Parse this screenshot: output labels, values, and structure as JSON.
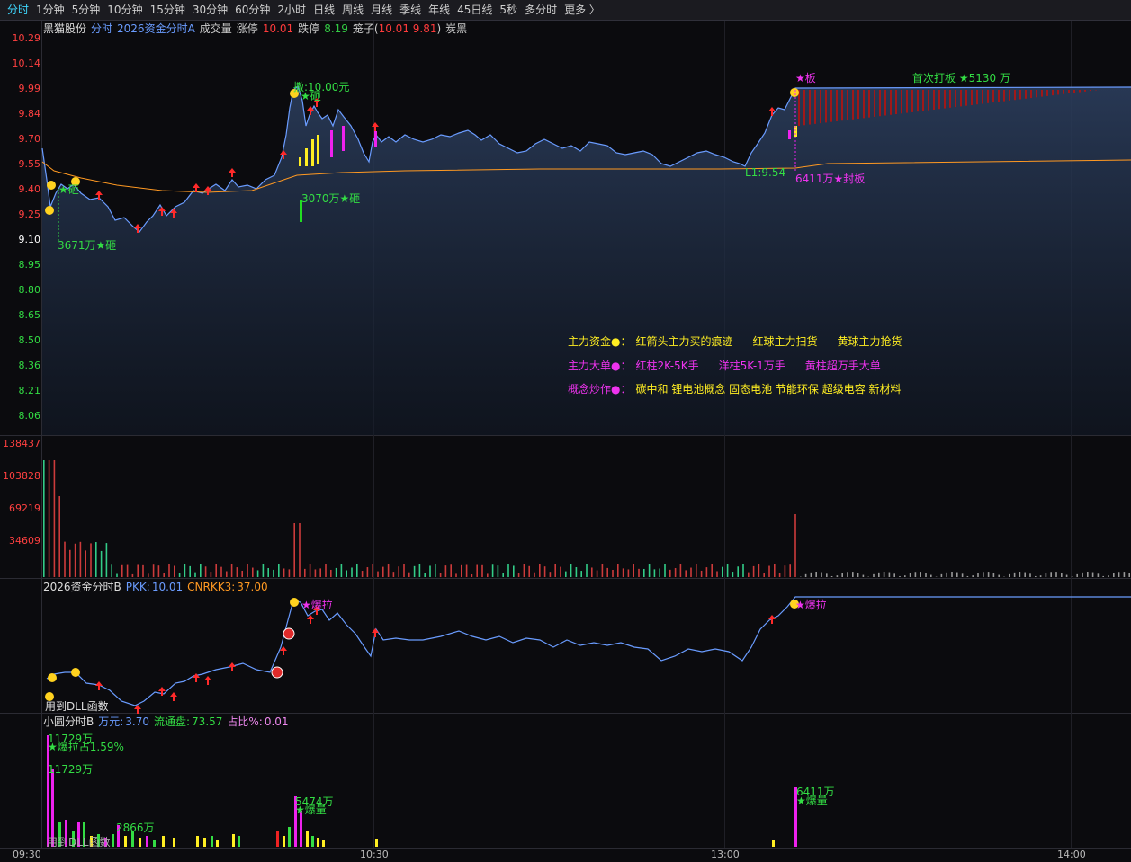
{
  "tabs": [
    "分时",
    "1分钟",
    "5分钟",
    "10分钟",
    "15分钟",
    "30分钟",
    "60分钟",
    "2小时",
    "日线",
    "周线",
    "月线",
    "季线",
    "年线",
    "45日线",
    "5秒",
    "多分时",
    "更多 〉"
  ],
  "active_tab": "分时",
  "colors": {
    "up": "#ff3b3b",
    "down": "#33cc44",
    "yellow": "#ffee22",
    "magenta": "#ee22ee",
    "line": "#6a9cff",
    "avg": "#ff9922",
    "bg": "#0b0b0e"
  },
  "price_header": {
    "name": "黑猫股份",
    "label1": "分时",
    "label2": "2026资金分时A",
    "label3": "成交量",
    "zt_label": "涨停",
    "zt_val": "10.01",
    "dt_label": "跌停",
    "dt_val": "8.19",
    "cage_label": "笼子(",
    "cage_val": "10.01 9.81",
    "cage_close": ")",
    "tail": "炭黑"
  },
  "price_axis": [
    {
      "v": "10.29",
      "c": "r"
    },
    {
      "v": "10.14",
      "c": "r"
    },
    {
      "v": "9.99",
      "c": "r"
    },
    {
      "v": "9.84",
      "c": "r"
    },
    {
      "v": "9.70",
      "c": "r"
    },
    {
      "v": "9.55",
      "c": "r"
    },
    {
      "v": "9.40",
      "c": "r"
    },
    {
      "v": "9.25",
      "c": "r"
    },
    {
      "v": "9.10",
      "c": "w"
    },
    {
      "v": "8.95",
      "c": "g"
    },
    {
      "v": "8.80",
      "c": "g"
    },
    {
      "v": "8.65",
      "c": "g"
    },
    {
      "v": "8.50",
      "c": "g"
    },
    {
      "v": "8.36",
      "c": "g"
    },
    {
      "v": "8.21",
      "c": "g"
    },
    {
      "v": "8.06",
      "c": "g"
    }
  ],
  "volume_axis": [
    "138437",
    "103828",
    "69219",
    "34609"
  ],
  "annotations": {
    "low_buy": "3671万★砸",
    "peak_label": "撒:10.00元",
    "peak_star": "★砸",
    "mid_vol": "3070万★砸",
    "board": "★板",
    "first_board": "首次打板 ★5130 万",
    "seal": "6411万★封板",
    "l1": "L1:9.54",
    "star_left": "★砸"
  },
  "legend": {
    "r1": {
      "label": "主力资金●：",
      "a": "红箭头主力买的痕迹",
      "b": "红球主力扫货",
      "c": "黄球主力抢货"
    },
    "r2": {
      "label": "主力大单●：",
      "a": "红柱2K-5K手",
      "b": "洋柱5K-1万手",
      "c": "黄柱超万手大单"
    },
    "r3": {
      "label": "概念炒作●：",
      "a": "碳中和 锂电池概念 固态电池 节能环保 超级电容 新材料"
    }
  },
  "ind_header": {
    "name": "2026资金分时B",
    "pkk_label": "PKK:",
    "pkk": "10.01",
    "cn_label": "CNRKK3:",
    "cn": "37.00"
  },
  "ind_ann": {
    "a": "★爆拉",
    "b": "★爆拉",
    "dll": "用到DLL函数"
  },
  "small_header": {
    "name": "小圆分时B",
    "w_label": "万元:",
    "w": "3.70",
    "lt_label": "流通盘:",
    "lt": "73.57",
    "zb_label": "占比%:",
    "zb": "0.01"
  },
  "small_ann": {
    "a1": "11729万",
    "a2": "★爆拉占1.59%",
    "a3": "11729万",
    "b": "2866万",
    "c1": "5474万",
    "c2": "★爆量",
    "d1": "6411万",
    "d2": "★爆量",
    "e": "用到DLL函数"
  },
  "time_axis": [
    "09:30",
    "10:30",
    "13:00",
    "14:00"
  ]
}
